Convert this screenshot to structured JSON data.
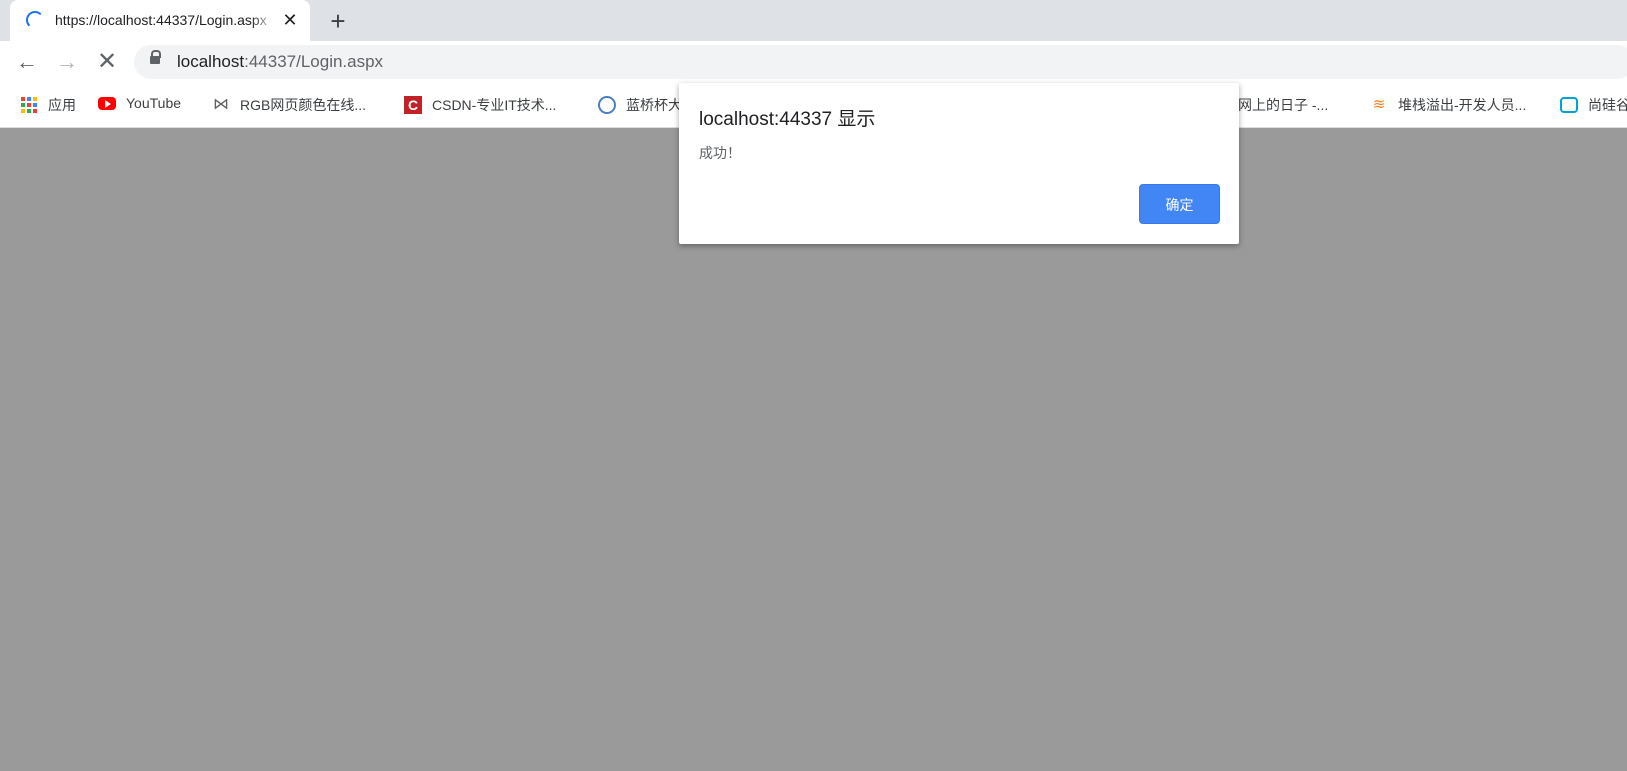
{
  "tab": {
    "title": "https://localhost:44337/Login.aspx"
  },
  "toolbar": {
    "back_icon": "back-arrow-icon",
    "forward_icon": "forward-arrow-icon",
    "stop_icon": "stop-loading-icon",
    "url_host": "localhost",
    "url_rest": ":44337/Login.aspx"
  },
  "bookmarks": [
    {
      "label": "应用",
      "icon": "apps-grid-icon"
    },
    {
      "label": "YouTube",
      "icon": "youtube-icon"
    },
    {
      "label": "RGB网页颜色在线...",
      "icon": "rgb-icon"
    },
    {
      "label": "CSDN-专业IT技术...",
      "icon": "csdn-icon"
    },
    {
      "label": "蓝桥杯大",
      "icon": "lanqiao-icon"
    },
    {
      "label": "网上的日子 -...",
      "icon": ""
    },
    {
      "label": "堆栈溢出-开发人员...",
      "icon": "stackoverflow-icon"
    },
    {
      "label": "尚硅谷",
      "icon": "bilibili-icon"
    }
  ],
  "dialog": {
    "title": "localhost:44337 显示",
    "message": "成功！",
    "ok_label": "确定"
  },
  "colors": {
    "overlay": "#9a9a9a",
    "accent": "#4285f4"
  }
}
